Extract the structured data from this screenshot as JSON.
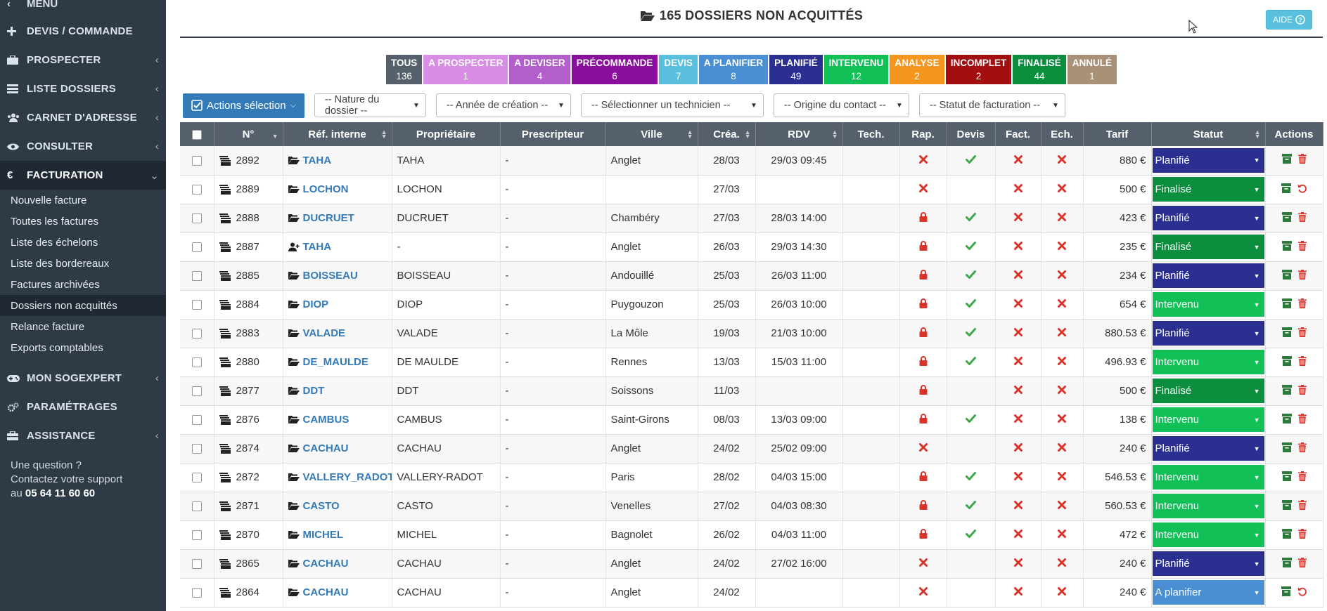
{
  "sidebar": {
    "menu_label": "MENU",
    "items": [
      {
        "label": "DEVIS / COMMANDE",
        "icon": "plus-icon",
        "chevron": ""
      },
      {
        "label": "PROSPECTER",
        "icon": "briefcase-icon",
        "chevron": "‹"
      },
      {
        "label": "LISTE DOSSIERS",
        "icon": "list-icon",
        "chevron": "‹"
      },
      {
        "label": "CARNET D'ADRESSE",
        "icon": "users-icon",
        "chevron": "‹"
      },
      {
        "label": "CONSULTER",
        "icon": "eye-icon",
        "chevron": "‹"
      },
      {
        "label": "FACTURATION",
        "icon": "euro-icon",
        "chevron": "⌄"
      }
    ],
    "submenu": [
      "Nouvelle facture",
      "Toutes les factures",
      "Liste des échelons",
      "Liste des bordereaux",
      "Factures archivées",
      "Dossiers non acquittés",
      "Relance facture",
      "Exports comptables"
    ],
    "submenu_active": "Dossiers non acquittés",
    "items_after": [
      {
        "label": "MON SOGEXPERT",
        "icon": "gamepad-icon",
        "chevron": "‹"
      },
      {
        "label": "PARAMÉTRAGES",
        "icon": "cogs-icon",
        "chevron": ""
      },
      {
        "label": "ASSISTANCE",
        "icon": "toolbox-icon",
        "chevron": "‹"
      }
    ],
    "help_line1": "Une question ?",
    "help_line2": "Contactez votre support",
    "help_prefix": "au ",
    "help_phone": "05 64 11 60 60"
  },
  "header": {
    "title": "165 DOSSIERS NON ACQUITTÉS",
    "aide_label": "AIDE"
  },
  "filters": [
    {
      "label": "TOUS",
      "count": "136",
      "color": "#56606d"
    },
    {
      "label": "A PROSPECTER",
      "count": "1",
      "color": "#d98ee6"
    },
    {
      "label": "A DEVISER",
      "count": "4",
      "color": "#b25fcb"
    },
    {
      "label": "PRÉCOMMANDE",
      "count": "6",
      "color": "#8a0f9c"
    },
    {
      "label": "DEVIS",
      "count": "7",
      "color": "#5bc0de"
    },
    {
      "label": "A PLANIFIER",
      "count": "8",
      "color": "#4a8fd4"
    },
    {
      "label": "PLANIFIÉ",
      "count": "49",
      "color": "#2b2f91"
    },
    {
      "label": "INTERVENU",
      "count": "12",
      "color": "#11c057"
    },
    {
      "label": "ANALYSE",
      "count": "2",
      "color": "#f5961f"
    },
    {
      "label": "INCOMPLET",
      "count": "2",
      "color": "#a30f10"
    },
    {
      "label": "FINALISÉ",
      "count": "44",
      "color": "#0b8f3e"
    },
    {
      "label": "ANNULÉ",
      "count": "1",
      "color": "#a99177"
    }
  ],
  "toolbar": {
    "actions_label": "Actions sélection",
    "selects": [
      "-- Nature du dossier --",
      "-- Année de création --",
      "-- Sélectionner un technicien --",
      "-- Origine du contact --",
      "-- Statut de facturation --"
    ]
  },
  "columns": [
    "",
    "N°",
    "Réf. interne",
    "Propriétaire",
    "Prescripteur",
    "Ville",
    "Créa.",
    "RDV",
    "Tech.",
    "Rap.",
    "Devis",
    "Fact.",
    "Ech.",
    "Tarif",
    "Statut",
    "Actions"
  ],
  "status_colors": {
    "Planifié": "#2b2f91",
    "Finalisé": "#0b8f3e",
    "Intervenu": "#11c057",
    "A planifier": "#4a8fd4"
  },
  "rows": [
    {
      "num": "2892",
      "ref": "TAHA",
      "ref_icon": "folder-open-icon",
      "owner": "TAHA",
      "presc": "-",
      "city": "Anglet",
      "crea": "28/03",
      "rdv": "29/03 09:45",
      "tech": "",
      "rap": "x",
      "devis": "ok",
      "fact": "x",
      "ech": "x",
      "tarif": "880 €",
      "status": "Planifié",
      "action2": "trash"
    },
    {
      "num": "2889",
      "ref": "LOCHON",
      "ref_icon": "folder-open-icon",
      "owner": "LOCHON",
      "presc": "-",
      "city": "",
      "crea": "27/03",
      "rdv": "",
      "tech": "",
      "rap": "x",
      "devis": "",
      "fact": "x",
      "ech": "x",
      "tarif": "500 €",
      "status": "Finalisé",
      "action2": "undo"
    },
    {
      "num": "2888",
      "ref": "DUCRUET",
      "ref_icon": "folder-open-icon",
      "owner": "DUCRUET",
      "presc": "-",
      "city": "Chambéry",
      "crea": "27/03",
      "rdv": "28/03 14:00",
      "tech": "",
      "rap": "lock",
      "devis": "ok",
      "fact": "x",
      "ech": "x",
      "tarif": "423 €",
      "status": "Planifié",
      "action2": "trash"
    },
    {
      "num": "2887",
      "ref": "TAHA",
      "ref_icon": "user-plus-icon",
      "owner": "-",
      "presc": "-",
      "city": "Anglet",
      "crea": "26/03",
      "rdv": "29/03 14:30",
      "tech": "",
      "rap": "lock",
      "devis": "ok",
      "fact": "x",
      "ech": "x",
      "tarif": "235 €",
      "status": "Finalisé",
      "action2": "trash"
    },
    {
      "num": "2885",
      "ref": "BOISSEAU",
      "ref_icon": "folder-open-icon",
      "owner": "BOISSEAU",
      "presc": "-",
      "city": "Andouillé",
      "crea": "25/03",
      "rdv": "26/03 11:00",
      "tech": "",
      "rap": "lock",
      "devis": "ok",
      "fact": "x",
      "ech": "x",
      "tarif": "234 €",
      "status": "Planifié",
      "action2": "trash"
    },
    {
      "num": "2884",
      "ref": "DIOP",
      "ref_icon": "folder-open-icon",
      "owner": "DIOP",
      "presc": "-",
      "city": "Puygouzon",
      "crea": "25/03",
      "rdv": "26/03 10:00",
      "tech": "",
      "rap": "lock",
      "devis": "ok",
      "fact": "x",
      "ech": "x",
      "tarif": "654 €",
      "status": "Intervenu",
      "action2": "trash"
    },
    {
      "num": "2883",
      "ref": "VALADE",
      "ref_icon": "folder-open-icon",
      "owner": "VALADE",
      "presc": "-",
      "city": "La Môle",
      "crea": "19/03",
      "rdv": "21/03 10:00",
      "tech": "",
      "rap": "lock",
      "devis": "ok",
      "fact": "x",
      "ech": "x",
      "tarif": "880.53 €",
      "status": "Planifié",
      "action2": "trash"
    },
    {
      "num": "2880",
      "ref": "DE_MAULDE",
      "ref_icon": "folder-open-icon",
      "owner": "DE MAULDE",
      "presc": "-",
      "city": "Rennes",
      "crea": "13/03",
      "rdv": "15/03 11:00",
      "tech": "",
      "rap": "lock",
      "devis": "ok",
      "fact": "x",
      "ech": "x",
      "tarif": "496.93 €",
      "status": "Intervenu",
      "action2": "trash"
    },
    {
      "num": "2877",
      "ref": "DDT",
      "ref_icon": "folder-open-icon",
      "owner": "DDT",
      "presc": "-",
      "city": "Soissons",
      "crea": "11/03",
      "rdv": "",
      "tech": "",
      "rap": "lock",
      "devis": "",
      "fact": "x",
      "ech": "x",
      "tarif": "500 €",
      "status": "Finalisé",
      "action2": "trash"
    },
    {
      "num": "2876",
      "ref": "CAMBUS",
      "ref_icon": "folder-open-icon",
      "owner": "CAMBUS",
      "presc": "-",
      "city": "Saint-Girons",
      "crea": "08/03",
      "rdv": "13/03 09:00",
      "tech": "",
      "rap": "lock",
      "devis": "ok",
      "fact": "x",
      "ech": "x",
      "tarif": "138 €",
      "status": "Intervenu",
      "action2": "trash"
    },
    {
      "num": "2874",
      "ref": "CACHAU",
      "ref_icon": "folder-open-icon",
      "owner": "CACHAU",
      "presc": "-",
      "city": "Anglet",
      "crea": "24/02",
      "rdv": "25/02 09:00",
      "tech": "",
      "rap": "x",
      "devis": "",
      "fact": "x",
      "ech": "x",
      "tarif": "240 €",
      "status": "Planifié",
      "action2": "trash"
    },
    {
      "num": "2872",
      "ref": "VALLERY_RADOT",
      "ref_icon": "folder-open-icon",
      "owner": "VALLERY-RADOT",
      "presc": "-",
      "city": "Paris",
      "crea": "28/02",
      "rdv": "04/03 15:00",
      "tech": "",
      "rap": "lock",
      "devis": "ok",
      "fact": "x",
      "ech": "x",
      "tarif": "546.53 €",
      "status": "Intervenu",
      "action2": "trash"
    },
    {
      "num": "2871",
      "ref": "CASTO",
      "ref_icon": "folder-open-icon",
      "owner": "CASTO",
      "presc": "-",
      "city": "Venelles",
      "crea": "27/02",
      "rdv": "04/03 08:30",
      "tech": "",
      "rap": "lock",
      "devis": "ok",
      "fact": "x",
      "ech": "x",
      "tarif": "560.53 €",
      "status": "Intervenu",
      "action2": "trash"
    },
    {
      "num": "2870",
      "ref": "MICHEL",
      "ref_icon": "folder-open-icon",
      "owner": "MICHEL",
      "presc": "-",
      "city": "Bagnolet",
      "crea": "26/02",
      "rdv": "04/03 11:00",
      "tech": "",
      "rap": "lock",
      "devis": "ok",
      "fact": "x",
      "ech": "x",
      "tarif": "472 €",
      "status": "Intervenu",
      "action2": "trash"
    },
    {
      "num": "2865",
      "ref": "CACHAU",
      "ref_icon": "folder-open-icon",
      "owner": "CACHAU",
      "presc": "-",
      "city": "Anglet",
      "crea": "24/02",
      "rdv": "27/02 16:00",
      "tech": "",
      "rap": "x",
      "devis": "",
      "fact": "x",
      "ech": "x",
      "tarif": "240 €",
      "status": "Planifié",
      "action2": "trash"
    },
    {
      "num": "2864",
      "ref": "CACHAU",
      "ref_icon": "folder-open-icon",
      "owner": "CACHAU",
      "presc": "-",
      "city": "Anglet",
      "crea": "24/02",
      "rdv": "",
      "tech": "",
      "rap": "x",
      "devis": "",
      "fact": "x",
      "ech": "x",
      "tarif": "240 €",
      "status": "A planifier",
      "action2": "undo"
    }
  ]
}
